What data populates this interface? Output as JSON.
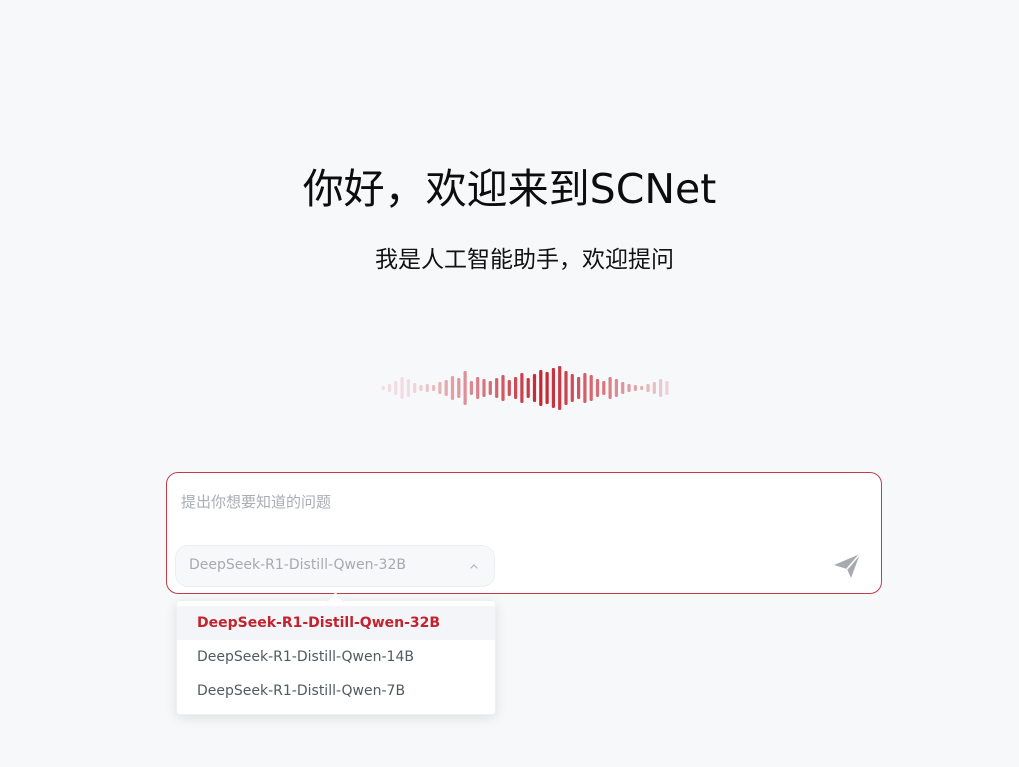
{
  "hero": {
    "title": "你好，欢迎来到SCNet",
    "subtitle": "我是人工智能助手，欢迎提问"
  },
  "input": {
    "placeholder": "提出你想要知道的问题",
    "value": ""
  },
  "model_select": {
    "selected": "DeepSeek-R1-Distill-Qwen-32B",
    "options": [
      "DeepSeek-R1-Distill-Qwen-32B",
      "DeepSeek-R1-Distill-Qwen-14B",
      "DeepSeek-R1-Distill-Qwen-7B"
    ]
  },
  "icons": {
    "wave": "voice-waveform-icon",
    "chevron": "chevron-up-icon",
    "send": "send-icon"
  },
  "colors": {
    "accent": "#c3222f",
    "background": "#f7f8fa"
  }
}
